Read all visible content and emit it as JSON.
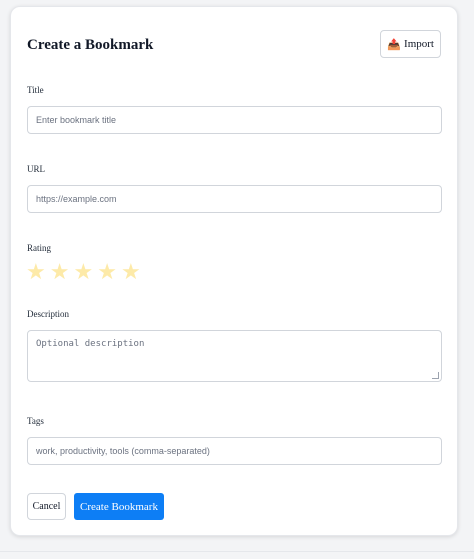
{
  "form": {
    "title": "Create a Bookmark",
    "import_label": "Import",
    "import_icon": "outbox-tray-icon",
    "fields": {
      "title": {
        "label": "Title",
        "placeholder": "Enter bookmark title",
        "value": ""
      },
      "url": {
        "label": "URL",
        "placeholder": "https://example.com",
        "value": ""
      },
      "rating": {
        "label": "Rating",
        "max": 5,
        "value": 0
      },
      "description": {
        "label": "Description",
        "placeholder": "Optional description",
        "value": ""
      },
      "tags": {
        "label": "Tags",
        "placeholder": "work, productivity, tools (comma-separated)",
        "value": ""
      }
    },
    "cancel_label": "Cancel",
    "submit_label": "Create Bookmark"
  },
  "colors": {
    "accent": "#0d7ef5",
    "star_empty": "#fdeaa8",
    "border": "#d1d5db"
  }
}
